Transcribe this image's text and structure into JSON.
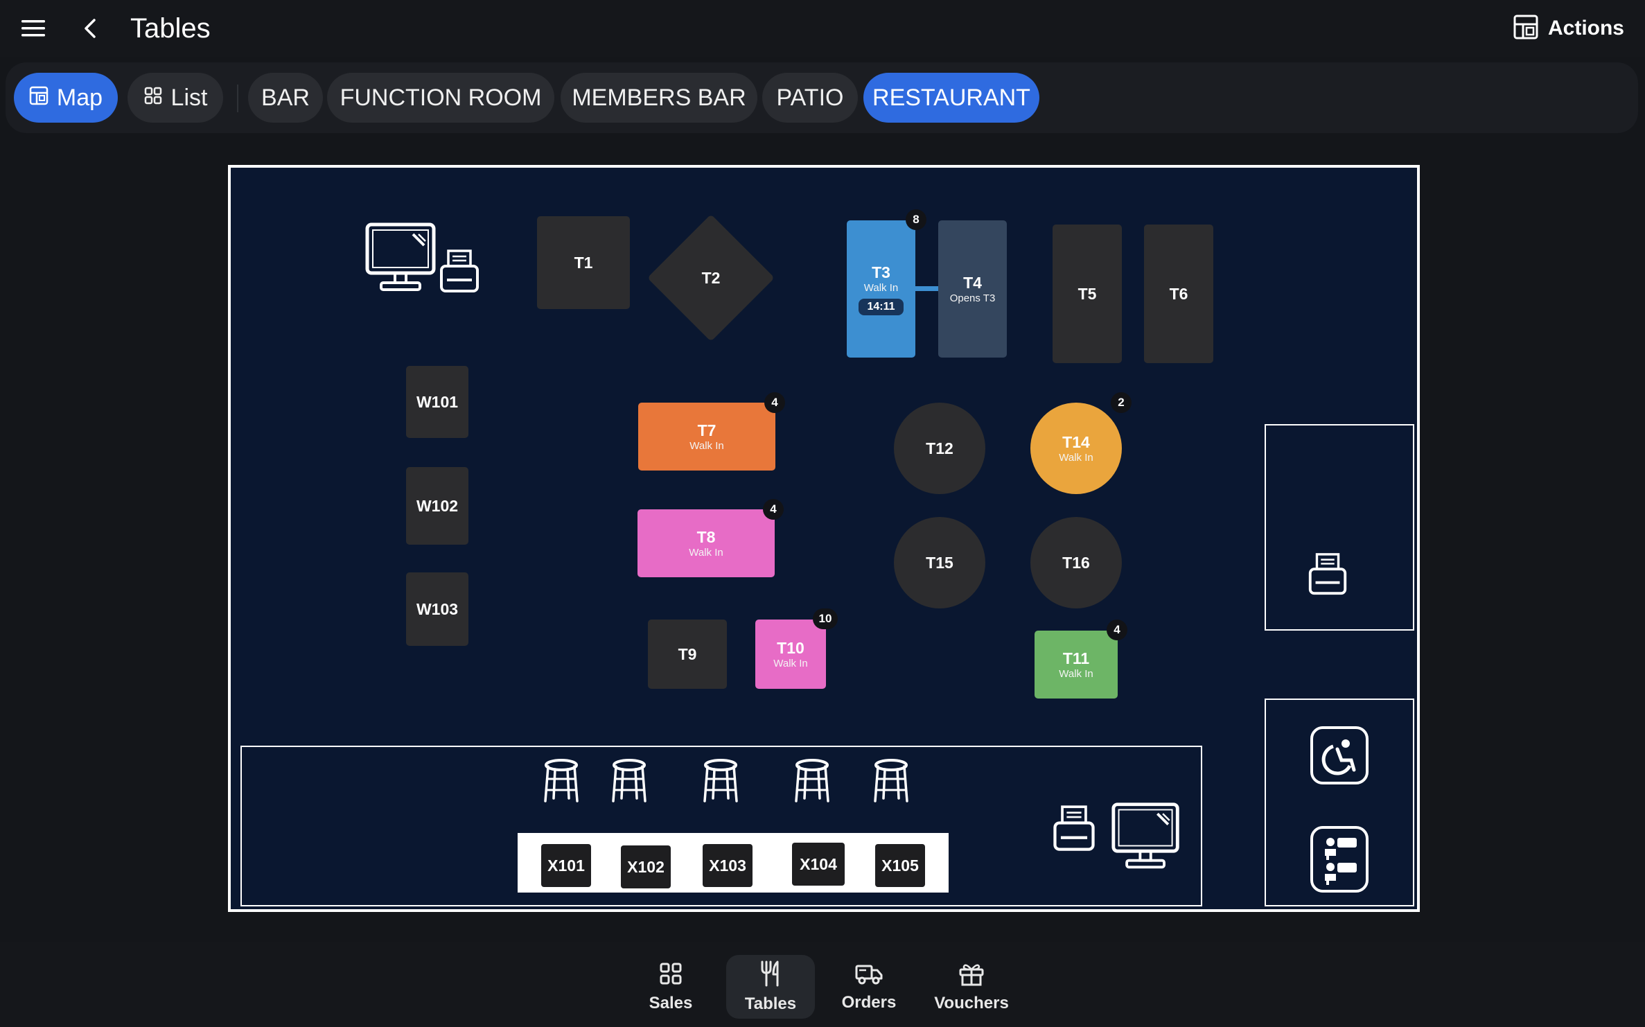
{
  "header": {
    "title": "Tables",
    "actions_label": "Actions"
  },
  "filters": {
    "view_map": "Map",
    "view_list": "List",
    "areas": [
      "BAR",
      "FUNCTION ROOM",
      "MEMBERS BAR",
      "PATIO",
      "RESTAURANT"
    ],
    "active_view": "Map",
    "active_area": "RESTAURANT"
  },
  "tables": {
    "T1": {
      "name": "T1"
    },
    "T2": {
      "name": "T2"
    },
    "T3": {
      "name": "T3",
      "status": "Walk In",
      "time": "14:11",
      "covers": "8",
      "color": "#3d8fd1"
    },
    "T4": {
      "name": "T4",
      "note": "Opens T3",
      "color": "#34465e"
    },
    "T5": {
      "name": "T5"
    },
    "T6": {
      "name": "T6"
    },
    "T7": {
      "name": "T7",
      "status": "Walk In",
      "covers": "4",
      "color": "#e8773a"
    },
    "T8": {
      "name": "T8",
      "status": "Walk In",
      "covers": "4",
      "color": "#e76cc6"
    },
    "T9": {
      "name": "T9"
    },
    "T10": {
      "name": "T10",
      "status": "Walk In",
      "covers": "10",
      "color": "#e76cc6"
    },
    "T11": {
      "name": "T11",
      "status": "Walk In",
      "covers": "4",
      "color": "#6db566"
    },
    "T12": {
      "name": "T12"
    },
    "T14": {
      "name": "T14",
      "status": "Walk In",
      "covers": "2",
      "color": "#eaa53d"
    },
    "T15": {
      "name": "T15"
    },
    "T16": {
      "name": "T16"
    },
    "W101": {
      "name": "W101"
    },
    "W102": {
      "name": "W102"
    },
    "W103": {
      "name": "W103"
    },
    "X101": {
      "name": "X101"
    },
    "X102": {
      "name": "X102"
    },
    "X103": {
      "name": "X103"
    },
    "X104": {
      "name": "X104"
    },
    "X105": {
      "name": "X105"
    }
  },
  "icons": {
    "pos_terminal": "computer-monitor-icon",
    "printer": "receipt-printer-icon",
    "bar_stool": "bar-stool-icon",
    "accessible_toilet": "accessible-toilet-icon",
    "toilets": "toilets-icon"
  },
  "bottom_nav": {
    "items": [
      "Sales",
      "Tables",
      "Orders",
      "Vouchers"
    ],
    "active": "Tables"
  }
}
